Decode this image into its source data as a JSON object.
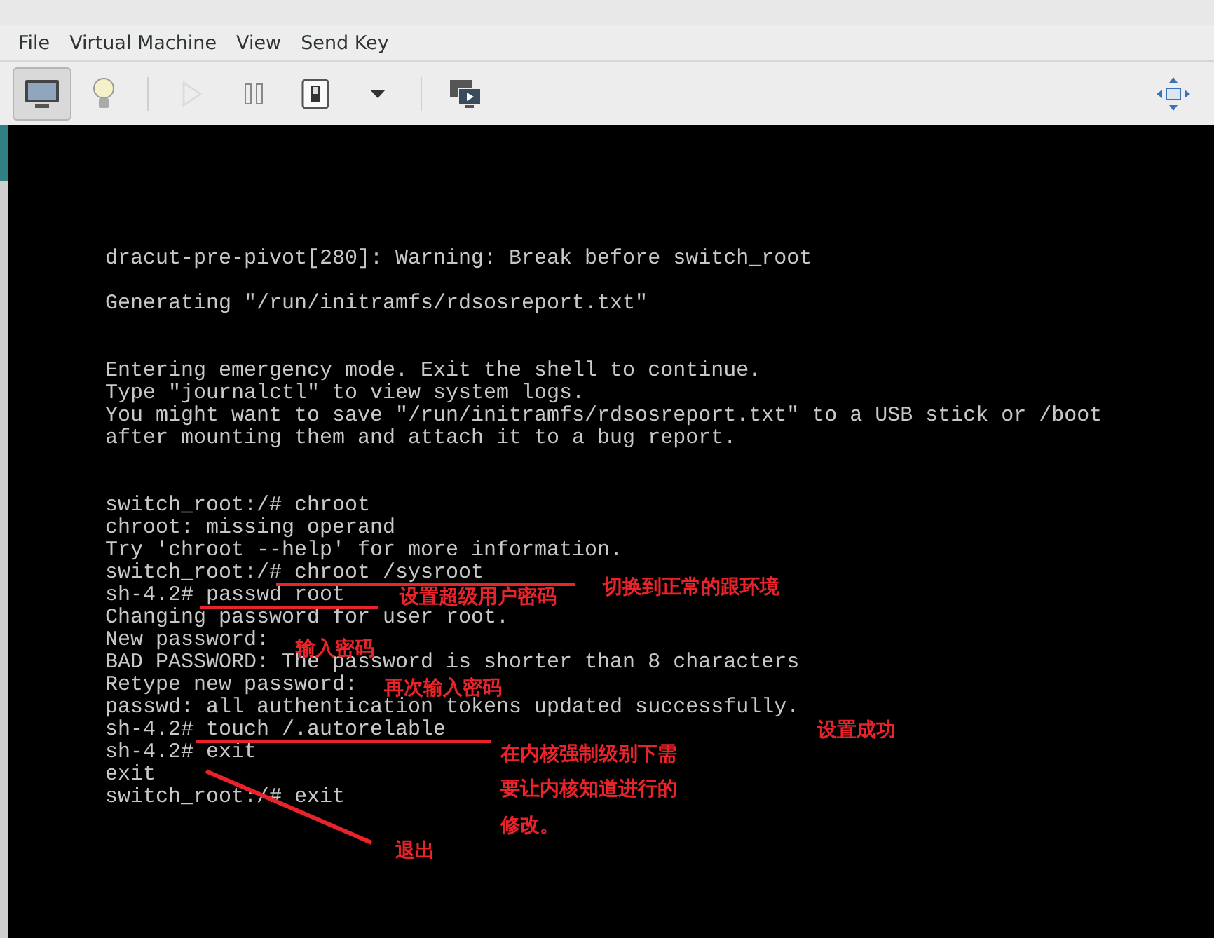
{
  "menu": [
    {
      "label": "File"
    },
    {
      "label": "Virtual Machine"
    },
    {
      "label": "View"
    },
    {
      "label": "Send Key"
    }
  ],
  "toolbar": [
    {
      "kind": "console",
      "selected": true,
      "disabled": false
    },
    {
      "kind": "details",
      "selected": false,
      "disabled": false
    },
    {
      "kind": "run",
      "selected": false,
      "disabled": true
    },
    {
      "kind": "pause",
      "selected": false,
      "disabled": false
    },
    {
      "kind": "shutdown",
      "selected": false,
      "disabled": false
    },
    {
      "kind": "dropdown",
      "selected": false,
      "disabled": false
    },
    {
      "kind": "snapshots",
      "selected": false,
      "disabled": false
    },
    {
      "kind": "resize",
      "selected": false,
      "disabled": false
    }
  ],
  "console": {
    "blocks": [
      [
        "dracut-pre-pivot[280]: Warning: Break before switch_root"
      ],
      [
        "Generating \"/run/initramfs/rdsosreport.txt\""
      ],
      [
        "Entering emergency mode. Exit the shell to continue.",
        "Type \"journalctl\" to view system logs.",
        "You might want to save \"/run/initramfs/rdsosreport.txt\" to a USB stick or /boot",
        "after mounting them and attach it to a bug report."
      ],
      [
        "switch_root:/# chroot",
        "chroot: missing operand",
        "Try 'chroot --help' for more information.",
        "switch_root:/# chroot /sysroot",
        "sh-4.2# passwd root",
        "Changing password for user root.",
        "New password:",
        "BAD PASSWORD: The password is shorter than 8 characters",
        "Retype new password:",
        "passwd: all authentication tokens updated successfully.",
        "sh-4.2# touch /.autorelable",
        "sh-4.2# exit",
        "exit",
        "switch_root:/# exit"
      ]
    ]
  },
  "annotations": [
    "切换到正常的跟环境",
    "设置超级用户密码",
    "输入密码",
    "再次输入密码",
    "设置成功",
    "在内核强制级别下需",
    "要让内核知道进行的",
    "修改。",
    "退出"
  ]
}
